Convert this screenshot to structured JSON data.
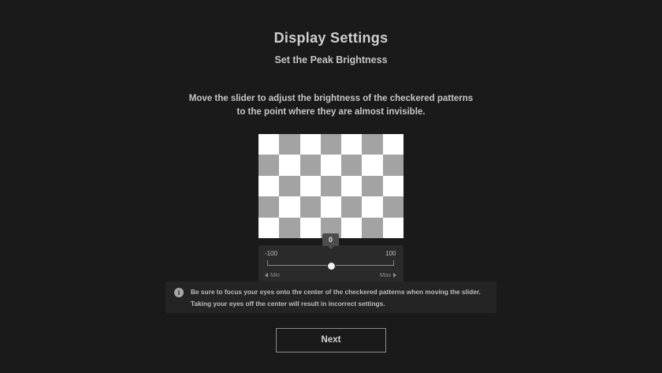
{
  "header": {
    "title": "Display Settings",
    "subtitle": "Set the Peak Brightness"
  },
  "instructions": {
    "line1": "Move the slider to adjust the brightness of the checkered patterns",
    "line2": "to the point where they are almost invisible."
  },
  "checker_pattern": {
    "columns": 7,
    "rows": 5,
    "light_color": "#ffffff",
    "dark_color": "#a3a3a3"
  },
  "slider": {
    "value": "0",
    "min_value_label": "-100",
    "max_value_label": "100",
    "min_caption": "Min",
    "max_caption": "Max",
    "min": -100,
    "max": 100,
    "current": 0
  },
  "info": {
    "icon": "info-icon",
    "icon_glyph": "i",
    "line1": "Be sure to focus your eyes onto the center of the checkered patterns when moving the slider.",
    "line2": "Taking your eyes off the center will result in incorrect settings."
  },
  "actions": {
    "next_label": "Next"
  },
  "colors": {
    "background": "#1a1a1a",
    "panel": "#2a2a2a"
  }
}
